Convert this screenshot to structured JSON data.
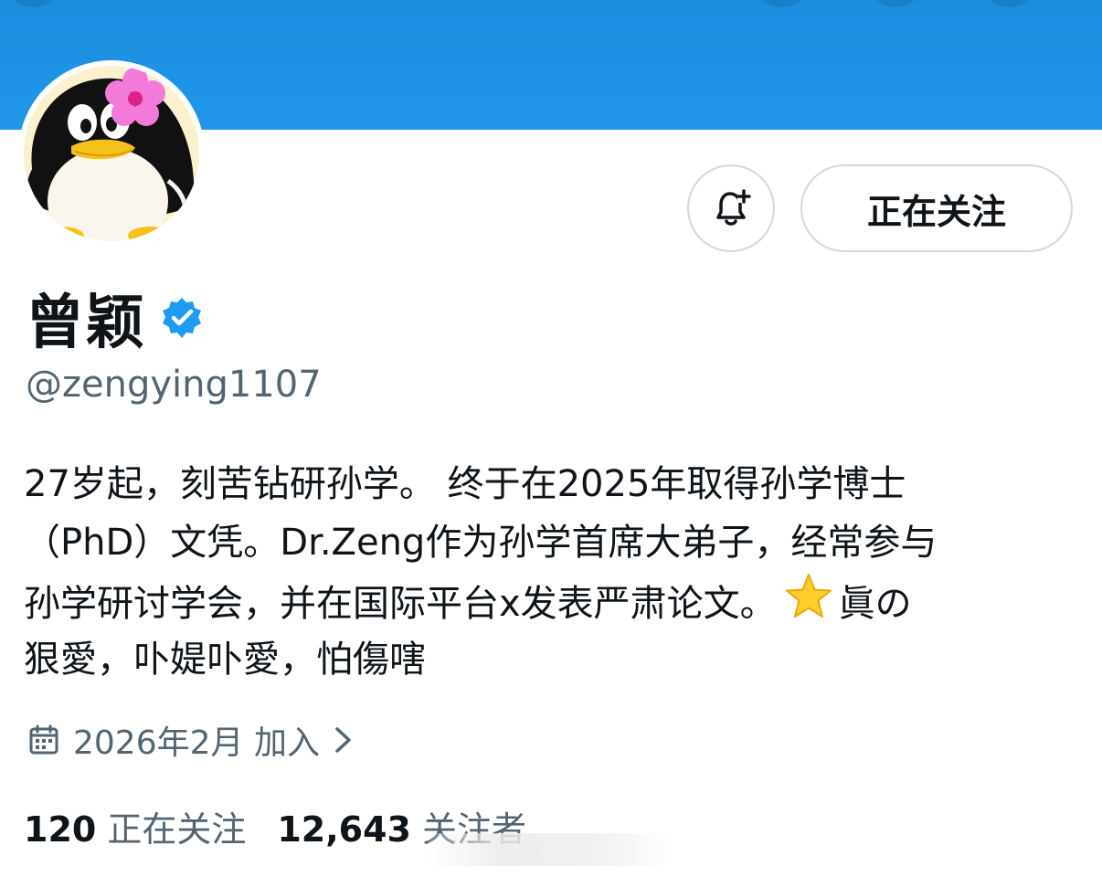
{
  "profile": {
    "display_name": "曾颖",
    "handle": "@zengying1107",
    "follow_button_label": "正在关注",
    "bio_lines": [
      "27岁起，刻苦钻研孙学。 终于在2025年取得孙学博士",
      "（PhD）文凭。Dr.Zeng作为孙学首席大弟子，经常参与",
      "孙学研讨学会，并在国际平台x发表严肃论文。",
      "狠愛，卟媞卟愛，怕傷嗐"
    ],
    "bio_line3_after_star": "眞の",
    "joined_text": "2026年2月 加入",
    "following_count": "120",
    "following_label": "正在关注",
    "followers_count": "12,643",
    "followers_label": "关注者"
  },
  "icons": {
    "verified": "verified-badge-icon",
    "bell": "notification-bell-plus-icon",
    "calendar": "calendar-icon",
    "chevron": "chevron-right-icon",
    "star": "star-emoji-icon"
  },
  "colors": {
    "banner": "#1d9bf0",
    "verified": "#1d9bf0",
    "secondary_text": "#536471",
    "border": "#cfd9de"
  }
}
